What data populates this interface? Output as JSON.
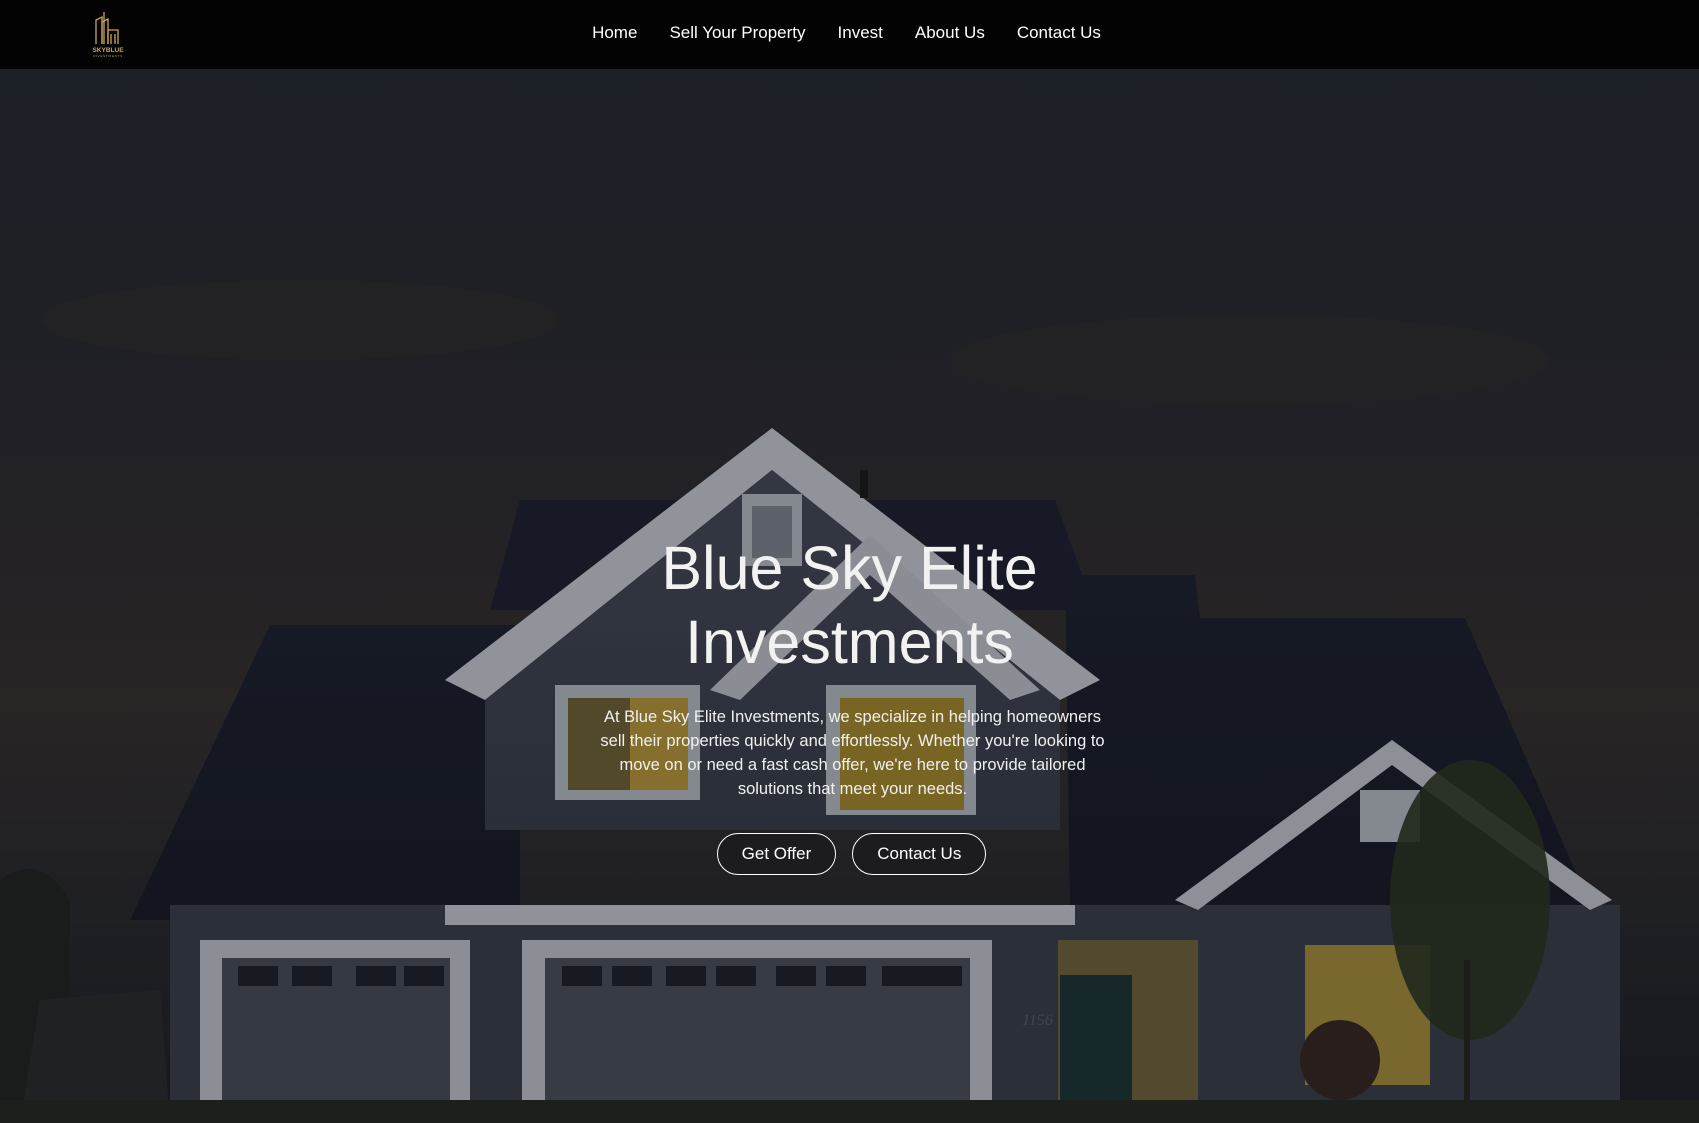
{
  "brand": {
    "logo_icon": "skyblue-buildings-logo",
    "logo_text": "SKYBLUE",
    "logo_subtext": "INVESTMENTS",
    "logo_color": "#c9a55a"
  },
  "nav": {
    "items": [
      {
        "label": "Home"
      },
      {
        "label": "Sell Your Property"
      },
      {
        "label": "Invest"
      },
      {
        "label": "About Us"
      },
      {
        "label": "Contact Us"
      }
    ]
  },
  "hero": {
    "title_line1": "Blue Sky Elite",
    "title_line2": "Investments",
    "description": "At Blue Sky Elite Investments, we specialize in helping homeowners sell their properties quickly and effortlessly. Whether you're looking to move on or need a fast cash offer, we're here to provide tailored solutions that meet your needs.",
    "primary_button": "Get Offer",
    "secondary_button": "Contact Us",
    "house_number": "1156",
    "background_image": "house-at-dusk-photo"
  },
  "colors": {
    "header_bg": "#030303",
    "text": "#ffffff",
    "window_glow": "#d6b43a"
  }
}
